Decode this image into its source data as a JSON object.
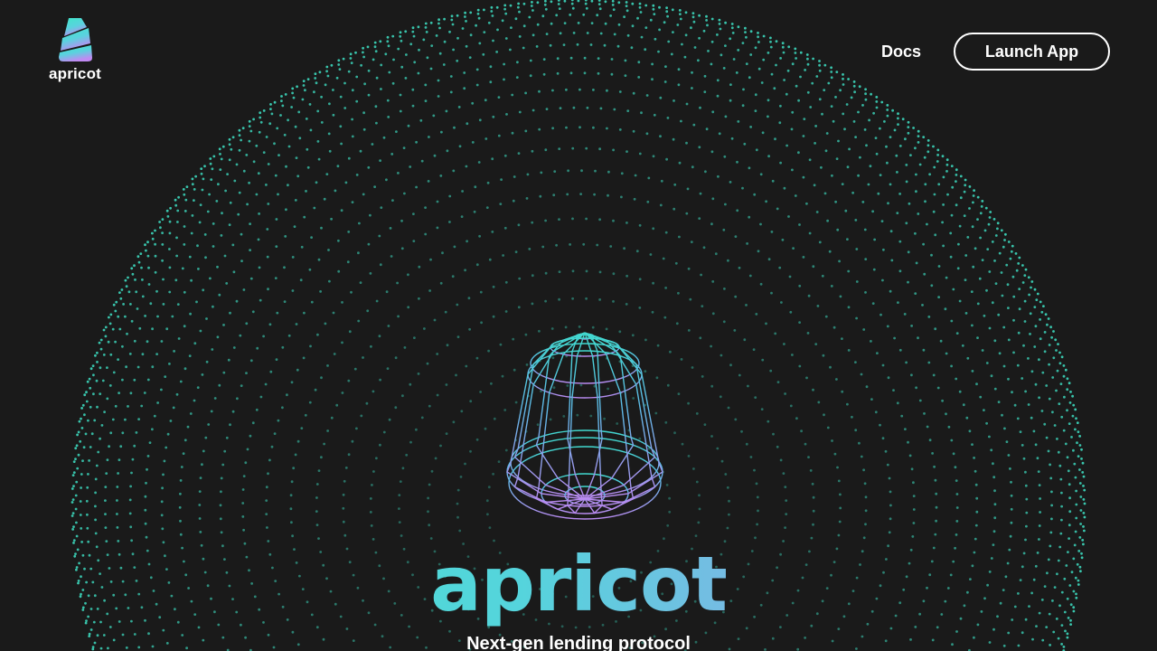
{
  "header": {
    "logo_text": "apricot",
    "nav": {
      "docs_label": "Docs",
      "launch_label": "Launch App"
    }
  },
  "hero": {
    "title": "apricot",
    "tagline": "Next-gen lending protocol"
  },
  "colors": {
    "background": "#1a1a1a",
    "accent_teal": "#3fe6c9",
    "accent_purple": "#b889f2",
    "text": "#ffffff"
  },
  "icons": {
    "logo": "apricot-logo-icon",
    "hero": "wireframe-apricot-icon"
  }
}
